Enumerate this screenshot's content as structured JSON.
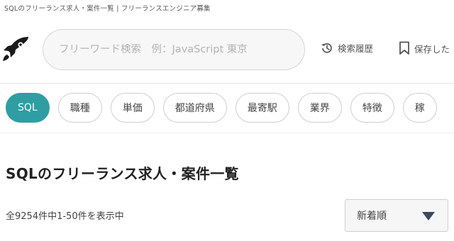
{
  "banner": {
    "text": "SQLのフリーランス求人・案件一覧 | フリーランスエンジニア募集"
  },
  "header": {
    "search_placeholder": "フリーワード検索　例：JavaScript 東京",
    "history_label": "検索履歴",
    "saved_label": "保存した"
  },
  "filters": {
    "chips": [
      {
        "label": "SQL",
        "active": true
      },
      {
        "label": "職種"
      },
      {
        "label": "単価"
      },
      {
        "label": "都道府県"
      },
      {
        "label": "最寄駅"
      },
      {
        "label": "業界"
      },
      {
        "label": "特徴"
      },
      {
        "label": "稼"
      }
    ]
  },
  "main": {
    "title": "SQLのフリーランス求人・案件一覧",
    "result_count": "全9254件中1-50件を表示中",
    "sort_selected": "新着順"
  },
  "colors": {
    "accent": "#2e9ea3",
    "sort_caret": "#3b4a5e"
  },
  "icons": {
    "logo": "rocket-logo-icon",
    "history": "history-icon",
    "saved": "bookmark-icon",
    "sort": "caret-down-icon"
  }
}
